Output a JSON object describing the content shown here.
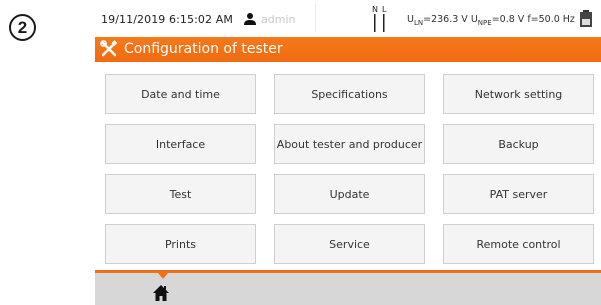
{
  "step_number": "2",
  "status_bar": {
    "datetime": "19/11/2019 6:15:02 AM",
    "user_icon": "user-icon",
    "user": "admin",
    "plug_icon": "plug-icon",
    "ln_label": "U",
    "ln_sub": "LN",
    "ln_value": "=236.3 V",
    "npe_label": "U",
    "npe_sub": "NPE",
    "npe_value": "=0.8 V",
    "freq": "f=50.0 Hz",
    "battery_icon": "battery-icon",
    "plug_n": "N",
    "plug_l": "L"
  },
  "title_bar": {
    "icon": "tools-icon",
    "title": "Configuration of tester"
  },
  "menu": [
    {
      "label": "Date and time"
    },
    {
      "label": "Specifications"
    },
    {
      "label": "Network setting"
    },
    {
      "label": "Interface"
    },
    {
      "label": "About tester and producer"
    },
    {
      "label": "Backup"
    },
    {
      "label": "Test"
    },
    {
      "label": "Update"
    },
    {
      "label": "PAT server"
    },
    {
      "label": "Prints"
    },
    {
      "label": "Service"
    },
    {
      "label": "Remote control"
    }
  ],
  "bottom_bar": {
    "home_icon": "home-icon"
  },
  "colors": {
    "accent": "#f07018",
    "tile_bg": "#f4f4f4",
    "bottom_bg": "#d7d7d7"
  }
}
